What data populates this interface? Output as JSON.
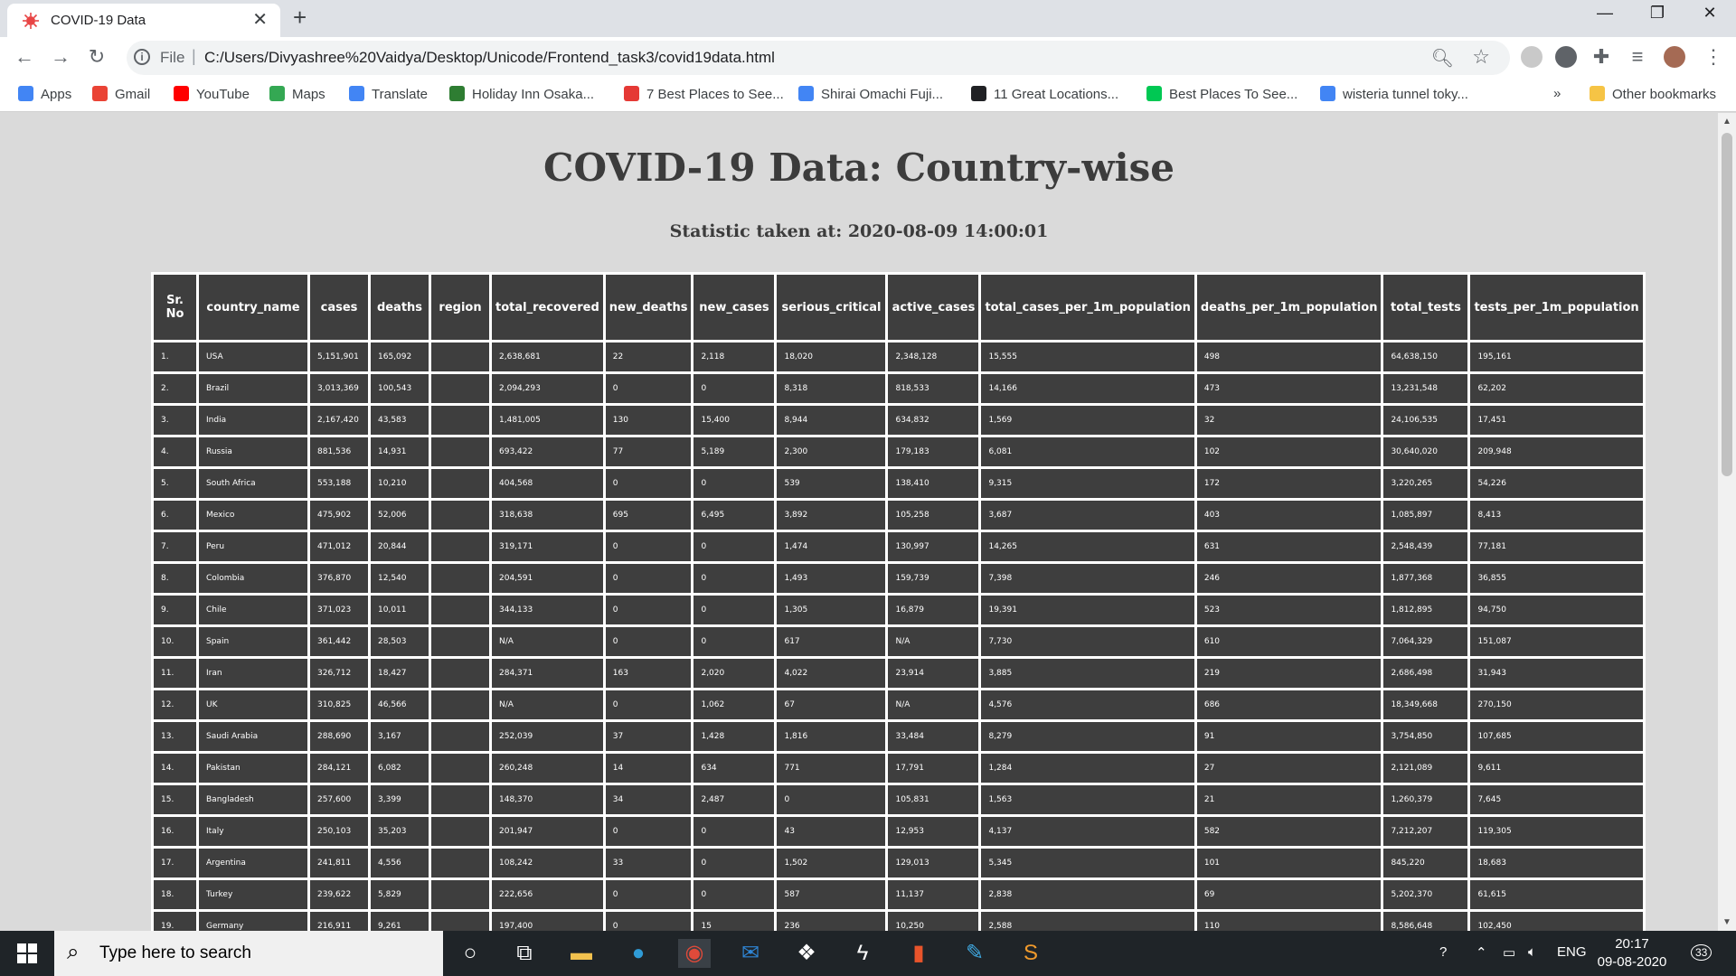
{
  "browser": {
    "tab_title": "COVID-19 Data",
    "tab_close": "✕",
    "new_tab": "+",
    "scheme_label": "File",
    "address_sep": "|",
    "url": "C:/Users/Divyashree%20Vaidya/Desktop/Unicode/Frontend_task3/covid19data.html",
    "window_controls": {
      "minimize": "—",
      "maximize": "❐",
      "close": "✕"
    },
    "bookmarks": [
      {
        "label": "Apps",
        "color": "#4285f4"
      },
      {
        "label": "Gmail",
        "color": "#ea4335"
      },
      {
        "label": "YouTube",
        "color": "#ff0000"
      },
      {
        "label": "Maps",
        "color": "#34a853"
      },
      {
        "label": "Translate",
        "color": "#4285f4"
      },
      {
        "label": "Holiday Inn Osaka...",
        "color": "#2e7d32"
      },
      {
        "label": "7 Best Places to See...",
        "color": "#e53935"
      },
      {
        "label": "Shirai Omachi Fuji...",
        "color": "#4285f4"
      },
      {
        "label": "11 Great Locations...",
        "color": "#202124"
      },
      {
        "label": "Best Places To See...",
        "color": "#00c853"
      },
      {
        "label": "wisteria tunnel toky...",
        "color": "#4285f4"
      }
    ],
    "bookmarks_overflow": "»",
    "other_bookmarks": "Other bookmarks"
  },
  "page": {
    "title": "COVID-19 Data: Country-wise",
    "statistic_line": "Statistic taken at: 2020-08-09 14:00:01"
  },
  "table": {
    "headers": [
      "Sr. No",
      "country_name",
      "cases",
      "deaths",
      "region",
      "total_recovered",
      "new_deaths",
      "new_cases",
      "serious_critical",
      "active_cases",
      "total_cases_per_1m_population",
      "deaths_per_1m_population",
      "total_tests",
      "tests_per_1m_population"
    ],
    "rows": [
      [
        "1.",
        "USA",
        "5,151,901",
        "165,092",
        "",
        "2,638,681",
        "22",
        "2,118",
        "18,020",
        "2,348,128",
        "15,555",
        "498",
        "64,638,150",
        "195,161"
      ],
      [
        "2.",
        "Brazil",
        "3,013,369",
        "100,543",
        "",
        "2,094,293",
        "0",
        "0",
        "8,318",
        "818,533",
        "14,166",
        "473",
        "13,231,548",
        "62,202"
      ],
      [
        "3.",
        "India",
        "2,167,420",
        "43,583",
        "",
        "1,481,005",
        "130",
        "15,400",
        "8,944",
        "634,832",
        "1,569",
        "32",
        "24,106,535",
        "17,451"
      ],
      [
        "4.",
        "Russia",
        "881,536",
        "14,931",
        "",
        "693,422",
        "77",
        "5,189",
        "2,300",
        "179,183",
        "6,081",
        "102",
        "30,640,020",
        "209,948"
      ],
      [
        "5.",
        "South Africa",
        "553,188",
        "10,210",
        "",
        "404,568",
        "0",
        "0",
        "539",
        "138,410",
        "9,315",
        "172",
        "3,220,265",
        "54,226"
      ],
      [
        "6.",
        "Mexico",
        "475,902",
        "52,006",
        "",
        "318,638",
        "695",
        "6,495",
        "3,892",
        "105,258",
        "3,687",
        "403",
        "1,085,897",
        "8,413"
      ],
      [
        "7.",
        "Peru",
        "471,012",
        "20,844",
        "",
        "319,171",
        "0",
        "0",
        "1,474",
        "130,997",
        "14,265",
        "631",
        "2,548,439",
        "77,181"
      ],
      [
        "8.",
        "Colombia",
        "376,870",
        "12,540",
        "",
        "204,591",
        "0",
        "0",
        "1,493",
        "159,739",
        "7,398",
        "246",
        "1,877,368",
        "36,855"
      ],
      [
        "9.",
        "Chile",
        "371,023",
        "10,011",
        "",
        "344,133",
        "0",
        "0",
        "1,305",
        "16,879",
        "19,391",
        "523",
        "1,812,895",
        "94,750"
      ],
      [
        "10.",
        "Spain",
        "361,442",
        "28,503",
        "",
        "N/A",
        "0",
        "0",
        "617",
        "N/A",
        "7,730",
        "610",
        "7,064,329",
        "151,087"
      ],
      [
        "11.",
        "Iran",
        "326,712",
        "18,427",
        "",
        "284,371",
        "163",
        "2,020",
        "4,022",
        "23,914",
        "3,885",
        "219",
        "2,686,498",
        "31,943"
      ],
      [
        "12.",
        "UK",
        "310,825",
        "46,566",
        "",
        "N/A",
        "0",
        "1,062",
        "67",
        "N/A",
        "4,576",
        "686",
        "18,349,668",
        "270,150"
      ],
      [
        "13.",
        "Saudi Arabia",
        "288,690",
        "3,167",
        "",
        "252,039",
        "37",
        "1,428",
        "1,816",
        "33,484",
        "8,279",
        "91",
        "3,754,850",
        "107,685"
      ],
      [
        "14.",
        "Pakistan",
        "284,121",
        "6,082",
        "",
        "260,248",
        "14",
        "634",
        "771",
        "17,791",
        "1,284",
        "27",
        "2,121,089",
        "9,611"
      ],
      [
        "15.",
        "Bangladesh",
        "257,600",
        "3,399",
        "",
        "148,370",
        "34",
        "2,487",
        "0",
        "105,831",
        "1,563",
        "21",
        "1,260,379",
        "7,645"
      ],
      [
        "16.",
        "Italy",
        "250,103",
        "35,203",
        "",
        "201,947",
        "0",
        "0",
        "43",
        "12,953",
        "4,137",
        "582",
        "7,212,207",
        "119,305"
      ],
      [
        "17.",
        "Argentina",
        "241,811",
        "4,556",
        "",
        "108,242",
        "33",
        "0",
        "1,502",
        "129,013",
        "5,345",
        "101",
        "845,220",
        "18,683"
      ],
      [
        "18.",
        "Turkey",
        "239,622",
        "5,829",
        "",
        "222,656",
        "0",
        "0",
        "587",
        "11,137",
        "2,838",
        "69",
        "5,202,370",
        "61,615"
      ],
      [
        "19.",
        "Germany",
        "216,911",
        "9,261",
        "",
        "197,400",
        "0",
        "15",
        "236",
        "10,250",
        "2,588",
        "110",
        "8,586,648",
        "102,450"
      ]
    ]
  },
  "taskbar": {
    "search_placeholder": "Type here to search",
    "language": "ENG",
    "time": "20:17",
    "date": "09-08-2020",
    "notification_count": "33"
  }
}
